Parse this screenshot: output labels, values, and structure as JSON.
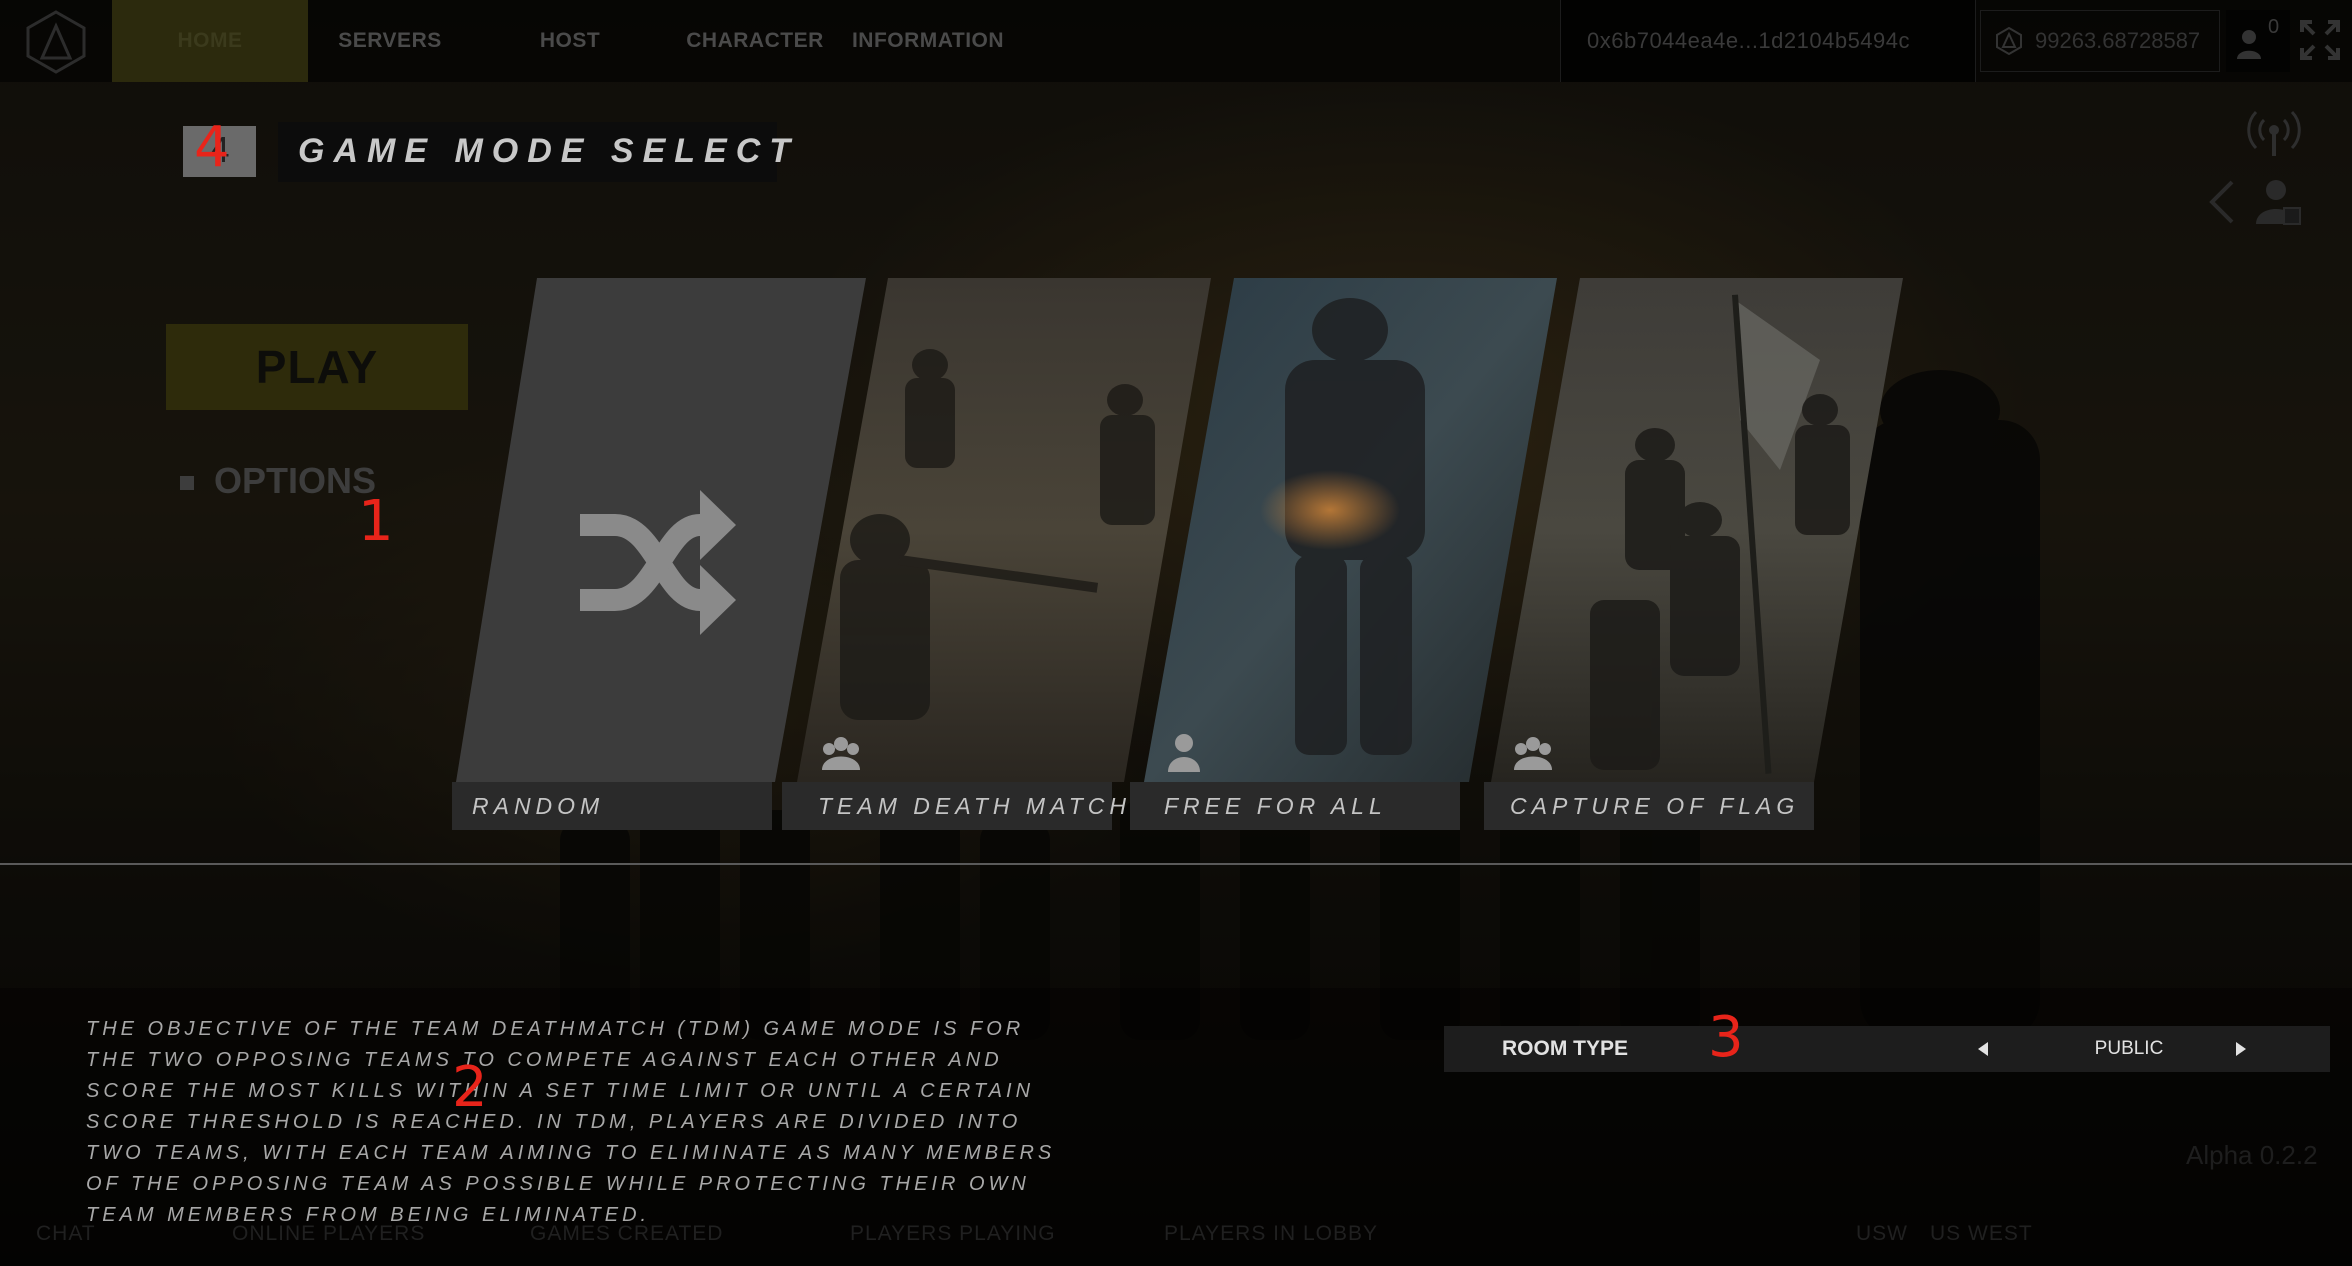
{
  "nav": {
    "items": [
      "HOME",
      "SERVERS",
      "HOST",
      "CHARACTER",
      "INFORMATION"
    ],
    "wallet_address": "0x6b7044ea4e...1d2104b5494c",
    "balance": "99263.68728587",
    "friends_count": "0"
  },
  "header": {
    "back_label": "4",
    "title": "GAME MODE SELECT"
  },
  "menu": {
    "play_label": "PLAY",
    "options_label": "OPTIONS"
  },
  "modes": [
    {
      "label": "RANDOM",
      "icon": "shuffle-icon"
    },
    {
      "label": "TEAM DEATH MATCH",
      "icon": "team-icon"
    },
    {
      "label": "FREE FOR ALL",
      "icon": "single-player-icon"
    },
    {
      "label": "CAPTURE OF FLAG",
      "icon": "team-icon"
    }
  ],
  "description": "The objective of the Team Deathmatch (TDM) game mode is for the two opposing teams to compete against each other and score the most kills within a set time limit or until a certain score threshold is reached. In TDM, players are divided into two teams, with each team aiming to eliminate as many members of the opposing team as possible while protecting their own team members from being eliminated.",
  "room": {
    "label": "ROOM TYPE",
    "value": "PUBLIC"
  },
  "footer": {
    "items": [
      "CHAT",
      "ONLINE PLAYERS",
      "GAMES CREATED",
      "PLAYERS PLAYING",
      "PLAYERS IN LOBBY",
      "USW",
      "US WEST"
    ],
    "version": "Alpha 0.2.2"
  },
  "annotations": [
    "1",
    "2",
    "3",
    "4"
  ],
  "colors": {
    "accent_dim_yellow": "#2e2b0b",
    "annotation_red": "#e8241a",
    "room_bar": "#1d1d1d"
  }
}
